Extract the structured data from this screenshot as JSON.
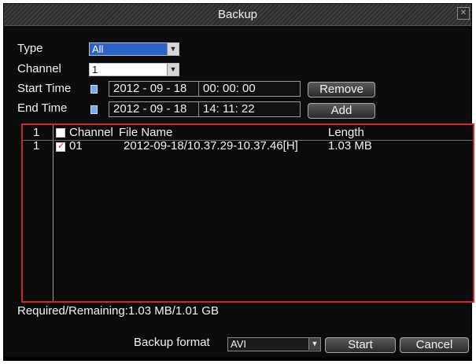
{
  "window": {
    "title": "Backup"
  },
  "filters": {
    "type_label": "Type",
    "type_value": "All",
    "channel_label": "Channel",
    "channel_value": "1",
    "start_label": "Start Time",
    "start_date": "2012 - 09 - 18",
    "start_time": "00: 00: 00",
    "end_label": "End Time",
    "end_date": "2012 - 09 - 18",
    "end_time": "14: 11: 22"
  },
  "buttons": {
    "remove": "Remove",
    "add": "Add",
    "start": "Start",
    "cancel": "Cancel"
  },
  "table": {
    "headers": {
      "index": "1",
      "channel": "Channel",
      "filename": "File Name",
      "length": "Length"
    },
    "rows": [
      {
        "index": "1",
        "checked": true,
        "channel": "01",
        "filename": "2012-09-18/10.37.29-10.37.46[H]",
        "length": "1.03 MB"
      }
    ]
  },
  "footer": {
    "required": "Required/Remaining:1.03 MB/1.01 GB",
    "format_label": "Backup format",
    "format_value": "AVI"
  },
  "colors": {
    "list_border": "#c92a2a",
    "select_highlight": "#2d63c8"
  },
  "icons": {
    "calendar": "calendar-icon",
    "close": "close-icon",
    "dropdown": "chevron-down-icon",
    "checkbox": "checkbox-icon"
  }
}
